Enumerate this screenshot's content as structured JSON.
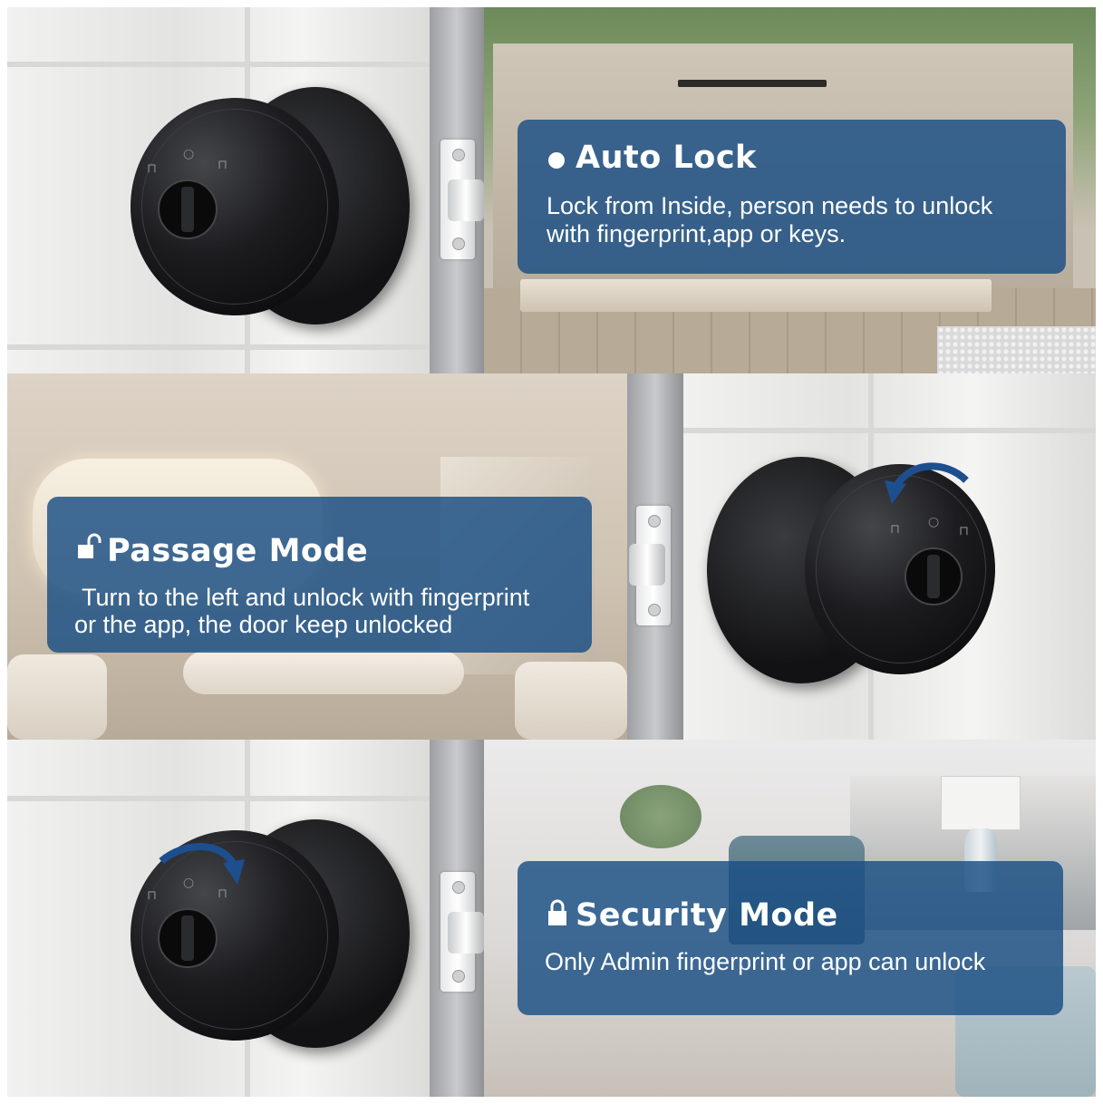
{
  "panels": {
    "auto_lock": {
      "title": "Auto Lock",
      "body_line1": "Lock from Inside, person needs to unlock",
      "body_line2": "with fingerprint,app or keys.",
      "icon": "bullet-dot-icon"
    },
    "passage_mode": {
      "title": "Passage Mode",
      "body_line1": "Turn to the left and unlock with fingerprint",
      "body_line2": "or the app, the door keep unlocked",
      "icon": "unlocked-padlock-icon"
    },
    "security_mode": {
      "title": "Security Mode",
      "body_line1": "Only Admin fingerprint or app can unlock",
      "icon": "locked-padlock-icon"
    }
  },
  "colors": {
    "info_box": "#184e84",
    "arrow": "#1d4f8f",
    "knob": "#111113"
  }
}
